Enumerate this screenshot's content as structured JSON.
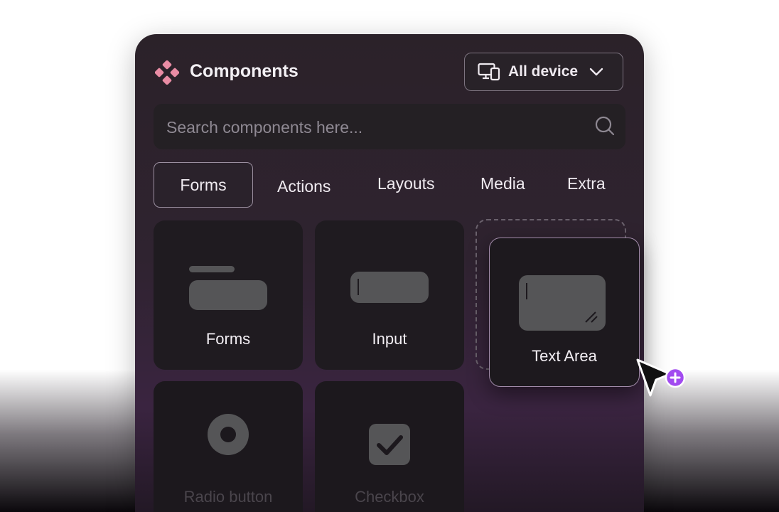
{
  "header": {
    "title": "Components",
    "device_label": "All device"
  },
  "search": {
    "placeholder": "Search components here..."
  },
  "tabs": [
    {
      "label": "Forms",
      "active": true
    },
    {
      "label": "Actions",
      "active": false
    },
    {
      "label": "Layouts",
      "active": false
    },
    {
      "label": "Media",
      "active": false
    },
    {
      "label": "Extra",
      "active": false
    }
  ],
  "components": [
    {
      "label": "Forms",
      "icon": "form-preview-icon"
    },
    {
      "label": "Input",
      "icon": "input-preview-icon"
    },
    {
      "label": "Text Area",
      "icon": "textarea-preview-icon",
      "dragging": true
    },
    {
      "label": "Radio button",
      "icon": "radio-preview-icon"
    },
    {
      "label": "Checkbox",
      "icon": "checkbox-preview-icon"
    }
  ],
  "colors": {
    "accent_logo": "#e98ca4",
    "cursor_badge": "#a24bf0",
    "panel": "#2f2330"
  }
}
